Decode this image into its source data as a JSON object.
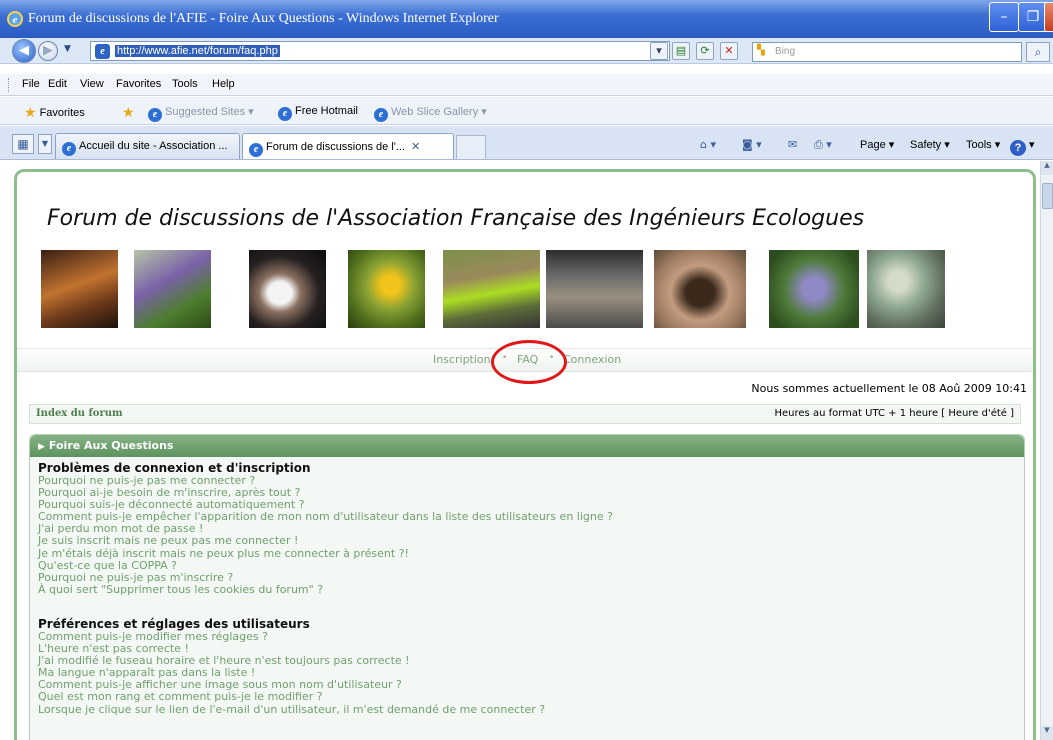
{
  "window": {
    "title": "Forum de discussions de l'AFIE - Foire Aux Questions - Windows Internet Explorer",
    "min_glyph": "–",
    "max_glyph": "❐",
    "close_glyph": "✕"
  },
  "address": {
    "url": "http://www.afie.net/forum/faq.php",
    "search_placeholder": "Bing",
    "back_glyph": "◀",
    "forward_glyph": "▶",
    "dropdown_glyph": "▼"
  },
  "menu": [
    "File",
    "Edit",
    "View",
    "Favorites",
    "Tools",
    "Help"
  ],
  "favorites_bar": {
    "favorites_label": "Favorites",
    "suggested_sites": "Suggested Sites ▾",
    "free_hotmail": "Free Hotmail",
    "web_slice": "Web Slice Gallery ▾"
  },
  "tabs": [
    {
      "label": "Accueil du site - Association ..."
    },
    {
      "label": "Forum de discussions de l'...",
      "close": "✕"
    }
  ],
  "command_bar": {
    "page": "Page ▾",
    "safety": "Safety ▾",
    "tools": "Tools ▾",
    "help": "?"
  },
  "forum": {
    "title": "Forum de discussions de l'Association Française des Ingénieurs Ecologues",
    "nav": {
      "inscription": "Inscription",
      "faq": "FAQ",
      "connexion": "Connexion",
      "sep": "•"
    },
    "datetime": "Nous sommes actuellement le 08 Aoû 2009 10:41",
    "breadcrumb_index": "Index du forum",
    "timezone": "Heures au format UTC + 1 heure [ Heure d'été ]",
    "faq_heading": "Foire Aux Questions",
    "sections": [
      {
        "heading": "Problèmes de connexion et d'inscription",
        "questions": [
          "Pourquoi ne puis-je pas me connecter ?",
          "Pourquoi ai-je besoin de m'inscrire, après tout ?",
          "Pourquoi suis-je déconnecté automatiquement ?",
          "Comment puis-je empêcher l'apparition de mon nom d'utilisateur dans la liste des utilisateurs en ligne ?",
          "J'ai perdu mon mot de passe !",
          "Je suis inscrit mais ne peux pas me connecter !",
          "Je m'étais déjà inscrit mais ne peux plus me connecter à présent ?!",
          "Qu'est-ce que la COPPA ?",
          "Pourquoi ne puis-je pas m'inscrire ?",
          "À quoi sert \"Supprimer tous les cookies du forum\" ?"
        ]
      },
      {
        "heading": "Préférences et réglages des utilisateurs",
        "questions": [
          "Comment puis-je modifier mes réglages ?",
          "L'heure n'est pas correcte !",
          "J'ai modifié le fuseau horaire et l'heure n'est toujours pas correcte !",
          "Ma langue n'apparaît pas dans la liste !",
          "Comment puis-je afficher une image sous mon nom d'utilisateur ?",
          "Quel est mon rang et comment puis-je le modifier ?",
          "Lorsque je clique sur le lien de l'e-mail d'un utilisateur, il m'est demandé de me connecter ?"
        ]
      }
    ]
  },
  "colors": {
    "accent_green": "#5e935e",
    "link_green": "#6f9f6f",
    "highlight_red": "#e01818"
  }
}
